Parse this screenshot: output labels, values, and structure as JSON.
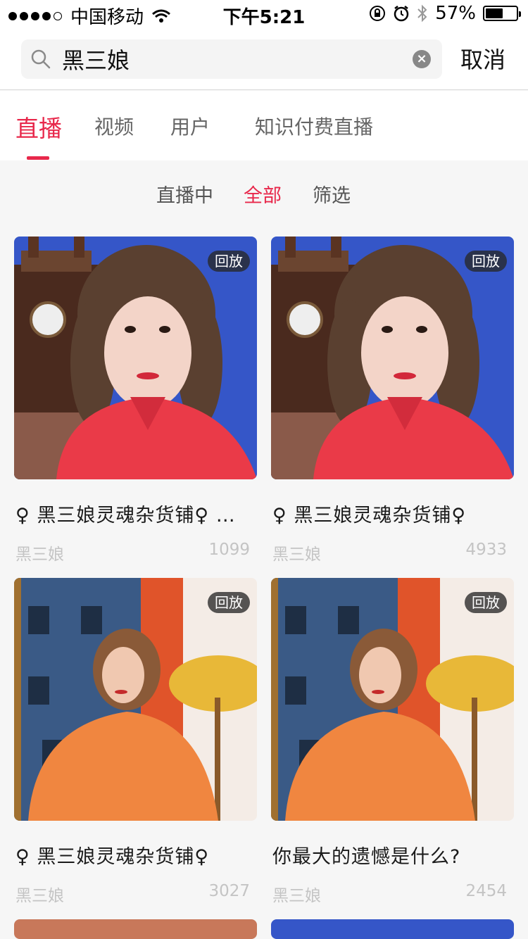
{
  "status_bar": {
    "carrier": "中国移动",
    "time": "下午5:21",
    "battery_percent": "57%",
    "battery_level": 0.57
  },
  "search": {
    "query": "黑三娘",
    "cancel_label": "取消"
  },
  "tabs": [
    {
      "label": "直播",
      "active": true
    },
    {
      "label": "视频",
      "active": false
    },
    {
      "label": "用户",
      "active": false
    },
    {
      "label": "知识付费直播",
      "active": false
    }
  ],
  "sub_filters": [
    {
      "label": "直播中",
      "active": false
    },
    {
      "label": "全部",
      "active": true
    },
    {
      "label": "筛选",
      "active": false
    }
  ],
  "colors": {
    "accent": "#e8284b",
    "muted": "#c4c4c4"
  },
  "cards": [
    {
      "badge": "回放",
      "title": "♀ 黑三娘灵魂杂货铺♀ …",
      "owner": "黑三娘",
      "count": "1099",
      "image": "woman-red-shirt-blue-bg"
    },
    {
      "badge": "回放",
      "title": "♀ 黑三娘灵魂杂货铺♀",
      "owner": "黑三娘",
      "count": "4933",
      "image": "woman-red-shirt-blue-bg"
    },
    {
      "badge": "回放",
      "title": "♀ 黑三娘灵魂杂货铺♀",
      "owner": "黑三娘",
      "count": "3027",
      "image": "woman-orange-sweater-lamp"
    },
    {
      "badge": "回放",
      "title": "你最大的遗憾是什么?",
      "owner": "黑三娘",
      "count": "2454",
      "image": "woman-orange-sweater-lamp"
    }
  ]
}
